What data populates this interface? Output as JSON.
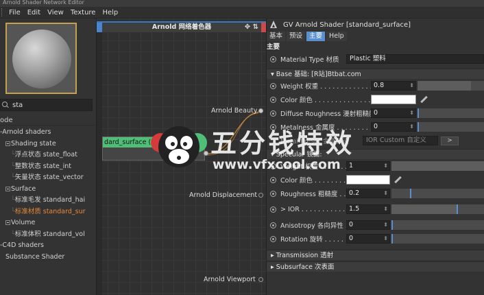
{
  "window": {
    "title": "Arnold Shader Network Editor"
  },
  "menu": [
    "File",
    "Edit",
    "View",
    "Texture",
    "Help"
  ],
  "left": {
    "search_value": "sta",
    "tree_header": "ode",
    "tree": [
      {
        "label": "-Arnold shaders",
        "level": 0,
        "toggle": false
      },
      {
        "label": "Shading state",
        "level": 1,
        "toggle": true
      },
      {
        "label": "浮点状态 state_float",
        "level": 2
      },
      {
        "label": "整数状态 state_int",
        "level": 2
      },
      {
        "label": "矢量状态 state_vector",
        "level": 2
      },
      {
        "label": "Surface",
        "level": 1,
        "toggle": true
      },
      {
        "label": "标准毛发 standard_hai",
        "level": 2
      },
      {
        "label": "标准材质 standard_sur",
        "level": 2,
        "active": true
      },
      {
        "label": "Volume",
        "level": 1,
        "toggle": true
      },
      {
        "label": "标准体积 standard_vol",
        "level": 2
      },
      {
        "label": "-C4D shaders",
        "level": 0
      },
      {
        "label": "Substance Shader",
        "level": 1
      }
    ]
  },
  "node_editor": {
    "title": "Arnold 网络着色器",
    "node_title": "dard_surface (standard_surface)",
    "node_port": "out",
    "outputs": [
      "Arnold Beauty",
      "Arnold Displacement",
      "Arnold Viewport"
    ]
  },
  "watermark": {
    "brand": "五分钱特效",
    "url": "www.vfxcool.com"
  },
  "attributes": {
    "header": "GV Arnold Shader [standard_surface]",
    "tabs": [
      "基本",
      "预设",
      "主要",
      "Help"
    ],
    "active_tab": "主要",
    "section": "主要",
    "material_type_label": "Material Type 材质",
    "material_type_value": "Plastic 塑料",
    "base_group": "▾ Base 基础: [R站]Btbat.com",
    "weight_label": "Weight 权重 . . . . . . . . . . . . . . .",
    "weight_value": "0.8",
    "color_label": "Color 颜色 . . . . . . . . . . . . . . . >",
    "diffuse_label": "Diffuse Roughness 漫射粗糙度",
    "diffuse_value": "0",
    "metalness_label": "Metalness 金属度 . . . . . . . . . .",
    "metalness_value": "0",
    "metal_preset_label": "Metal Preset 金属预设",
    "metal_preset_value": "IOR Custom 自定义",
    "metal_preset_btn": ">",
    "specular_group": "▾ Specular 镜面:",
    "spec_weight_label": "Weight 权重 . . . . . . . . . . . . . . .",
    "spec_weight_value": "1",
    "spec_color_label": "Color 颜色 . . . . . . . . . . . . . . .",
    "spec_rough_label": "Roughness 粗糙度 . . . . . . . . . .",
    "spec_rough_value": "0.2",
    "ior_label": "> IOR . . . . . . . . . . . . . . . . . . .",
    "ior_value": "1.5",
    "aniso_label": "Anisotropy 各向异性 . . . . . . . .",
    "aniso_value": "0",
    "rotation_label": "Rotation 旋转 . . . . . . . . . . . . .",
    "rotation_value": "0",
    "transmission_group": "▸ Transmission 透射",
    "subsurface_group": "▸ Subsurface 次表面",
    "sliders": {
      "weight": 0.8,
      "spec_weight": 1.0,
      "spec_rough": 0.2,
      "ior_fraction": 0.7
    },
    "colors": {
      "accent": "#5a8fd0",
      "node_green": "#4fbf78",
      "active_tree": "#e8893a",
      "swatch": "#ffffff"
    }
  }
}
